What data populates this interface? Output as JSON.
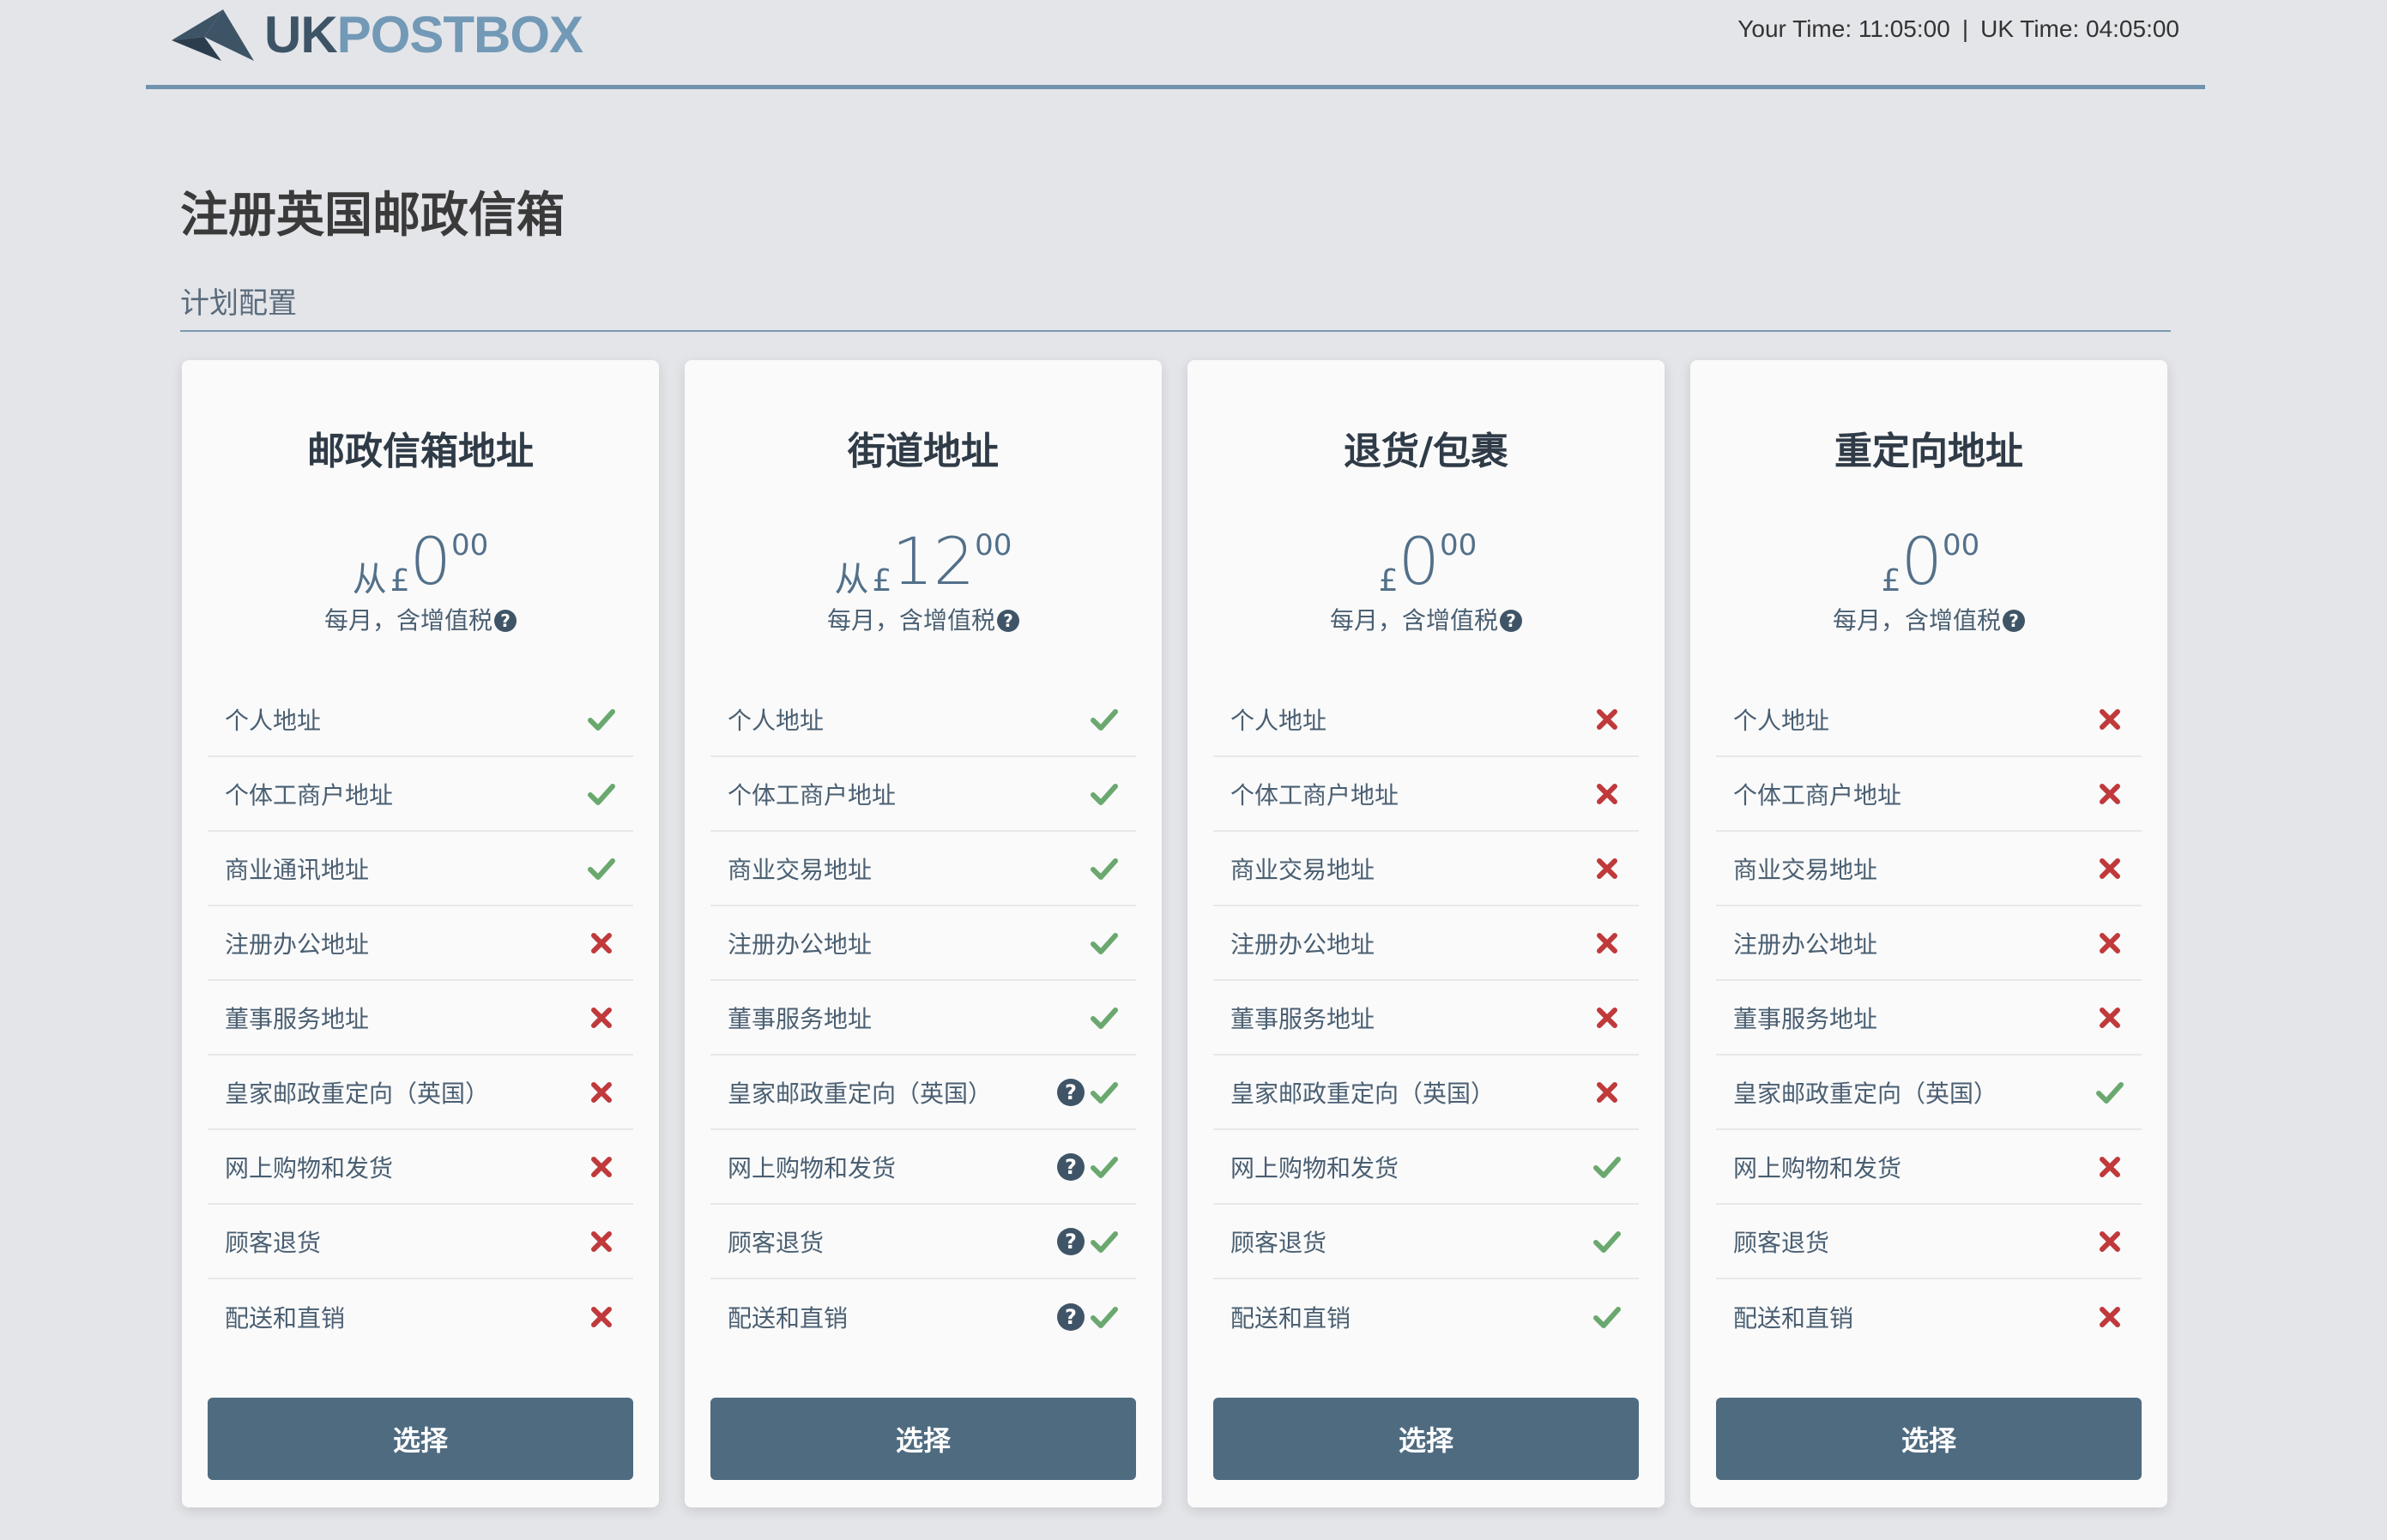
{
  "header": {
    "logo_uk": "UK",
    "logo_postbox": "POSTBOX",
    "your_time_label": "Your Time: 11:05:00",
    "separator": "|",
    "uk_time_label": "UK Time: 04:05:00"
  },
  "page": {
    "title": "注册英国邮政信箱",
    "subtitle": "计划配置"
  },
  "colors": {
    "check": "#6aa86f",
    "cross": "#c0393b",
    "button": "#4f6b80",
    "accent": "#6f93ad"
  },
  "plans": [
    {
      "title": "邮政信箱地址",
      "price_prefix": "从",
      "currency": "£",
      "price_int": "0",
      "price_dec": "00",
      "price_note": "每月，含增值税",
      "features": [
        {
          "label": "个人地址",
          "status": "check",
          "help": false
        },
        {
          "label": "个体工商户地址",
          "status": "check",
          "help": false
        },
        {
          "label": "商业通讯地址",
          "status": "check",
          "help": false
        },
        {
          "label": "注册办公地址",
          "status": "cross",
          "help": false
        },
        {
          "label": "董事服务地址",
          "status": "cross",
          "help": false
        },
        {
          "label": "皇家邮政重定向（英国）",
          "status": "cross",
          "help": false
        },
        {
          "label": "网上购物和发货",
          "status": "cross",
          "help": false
        },
        {
          "label": "顾客退货",
          "status": "cross",
          "help": false
        },
        {
          "label": "配送和直销",
          "status": "cross",
          "help": false
        }
      ],
      "button": "选择"
    },
    {
      "title": "街道地址",
      "price_prefix": "从",
      "currency": "£",
      "price_int": "12",
      "price_dec": "00",
      "price_note": "每月，含增值税",
      "features": [
        {
          "label": "个人地址",
          "status": "check",
          "help": false
        },
        {
          "label": "个体工商户地址",
          "status": "check",
          "help": false
        },
        {
          "label": "商业交易地址",
          "status": "check",
          "help": false
        },
        {
          "label": "注册办公地址",
          "status": "check",
          "help": false
        },
        {
          "label": "董事服务地址",
          "status": "check",
          "help": false
        },
        {
          "label": "皇家邮政重定向（英国）",
          "status": "check",
          "help": true
        },
        {
          "label": "网上购物和发货",
          "status": "check",
          "help": true
        },
        {
          "label": "顾客退货",
          "status": "check",
          "help": true
        },
        {
          "label": "配送和直销",
          "status": "check",
          "help": true
        }
      ],
      "button": "选择"
    },
    {
      "title": "退货/包裹",
      "price_prefix": "",
      "currency": "£",
      "price_int": "0",
      "price_dec": "00",
      "price_note": "每月，含增值税",
      "features": [
        {
          "label": "个人地址",
          "status": "cross",
          "help": false
        },
        {
          "label": "个体工商户地址",
          "status": "cross",
          "help": false
        },
        {
          "label": "商业交易地址",
          "status": "cross",
          "help": false
        },
        {
          "label": "注册办公地址",
          "status": "cross",
          "help": false
        },
        {
          "label": "董事服务地址",
          "status": "cross",
          "help": false
        },
        {
          "label": "皇家邮政重定向（英国）",
          "status": "cross",
          "help": false
        },
        {
          "label": "网上购物和发货",
          "status": "check",
          "help": false
        },
        {
          "label": "顾客退货",
          "status": "check",
          "help": false
        },
        {
          "label": "配送和直销",
          "status": "check",
          "help": false
        }
      ],
      "button": "选择"
    },
    {
      "title": "重定向地址",
      "price_prefix": "",
      "currency": "£",
      "price_int": "0",
      "price_dec": "00",
      "price_note": "每月，含增值税",
      "features": [
        {
          "label": "个人地址",
          "status": "cross",
          "help": false
        },
        {
          "label": "个体工商户地址",
          "status": "cross",
          "help": false
        },
        {
          "label": "商业交易地址",
          "status": "cross",
          "help": false
        },
        {
          "label": "注册办公地址",
          "status": "cross",
          "help": false
        },
        {
          "label": "董事服务地址",
          "status": "cross",
          "help": false
        },
        {
          "label": "皇家邮政重定向（英国）",
          "status": "check",
          "help": false
        },
        {
          "label": "网上购物和发货",
          "status": "cross",
          "help": false
        },
        {
          "label": "顾客退货",
          "status": "cross",
          "help": false
        },
        {
          "label": "配送和直销",
          "status": "cross",
          "help": false
        }
      ],
      "button": "选择"
    }
  ]
}
